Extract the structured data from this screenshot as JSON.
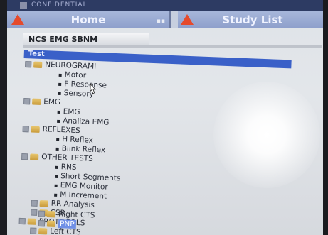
{
  "window": {
    "title_fragment": "CONFIDENTIAL"
  },
  "tabs": [
    {
      "label": "Home"
    },
    {
      "label": "Study List"
    }
  ],
  "panel": {
    "title": "NCS EMG SBNM"
  },
  "tree": {
    "header": "Test",
    "groups": [
      {
        "label": "NEUROGRAMI",
        "items": [
          "Motor",
          "F Response",
          "Sensory"
        ]
      },
      {
        "label": "EMG",
        "items": [
          "EMG",
          "Analiza EMG"
        ]
      },
      {
        "label": "REFLEXES",
        "items": [
          "H Reflex",
          "Blink Reflex"
        ]
      },
      {
        "label": "OTHER TESTS",
        "items": [
          "RNS",
          "Short Segments",
          "EMG Monitor",
          "M Increment",
          "RR Analysis",
          "SSR"
        ]
      },
      {
        "label": "PROTOCOLS",
        "items": [
          "Left CTS",
          "Right CTS",
          "PNP"
        ]
      }
    ]
  },
  "colors": {
    "tab_bg": "#9aaad3",
    "tree_header_bg": "#3a60c8",
    "warning_icon": "#e54a2c",
    "selected_item": "#6f8fe6"
  }
}
